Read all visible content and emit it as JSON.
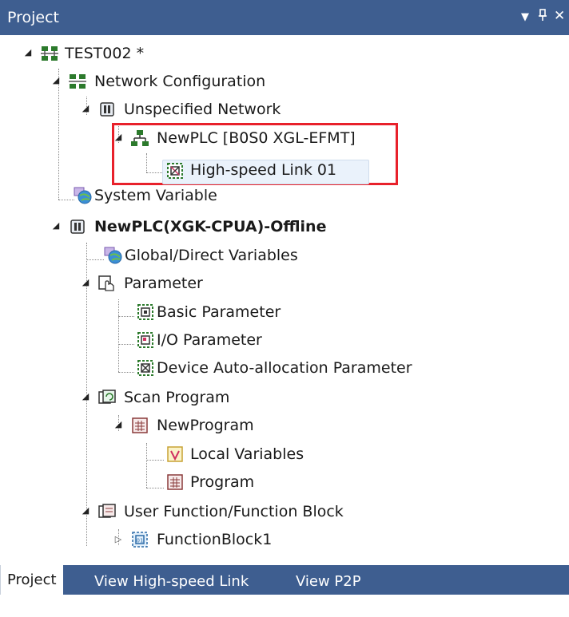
{
  "titlebar": {
    "title": "Project",
    "dropdown_glyph": "▼",
    "pin_glyph": "ꟾ",
    "close_glyph": "✕"
  },
  "tree": {
    "root": "TEST002 *",
    "network_config": "Network Configuration",
    "unspecified_network": "Unspecified Network",
    "newplc_link": "NewPLC [B0S0 XGL-EFMT]",
    "highspeed_link": "High-speed Link 01",
    "system_variable": "System Variable",
    "plc": "NewPLC(XGK-CPUA)-Offline",
    "global_vars": "Global/Direct Variables",
    "parameter": "Parameter",
    "basic_param": "Basic Parameter",
    "io_param": "I/O Parameter",
    "device_param": "Device Auto-allocation Parameter",
    "scan_program": "Scan Program",
    "new_program": "NewProgram",
    "local_vars": "Local Variables",
    "program": "Program",
    "user_function": "User Function/Function Block",
    "function_block": "FunctionBlock1"
  },
  "tabs": [
    "Project",
    "View High-speed Link",
    "View P2P"
  ],
  "colors": {
    "title_bg": "#3e5e90",
    "highlight_box": "#e8212b",
    "selection_bg": "#eaf2fb"
  }
}
